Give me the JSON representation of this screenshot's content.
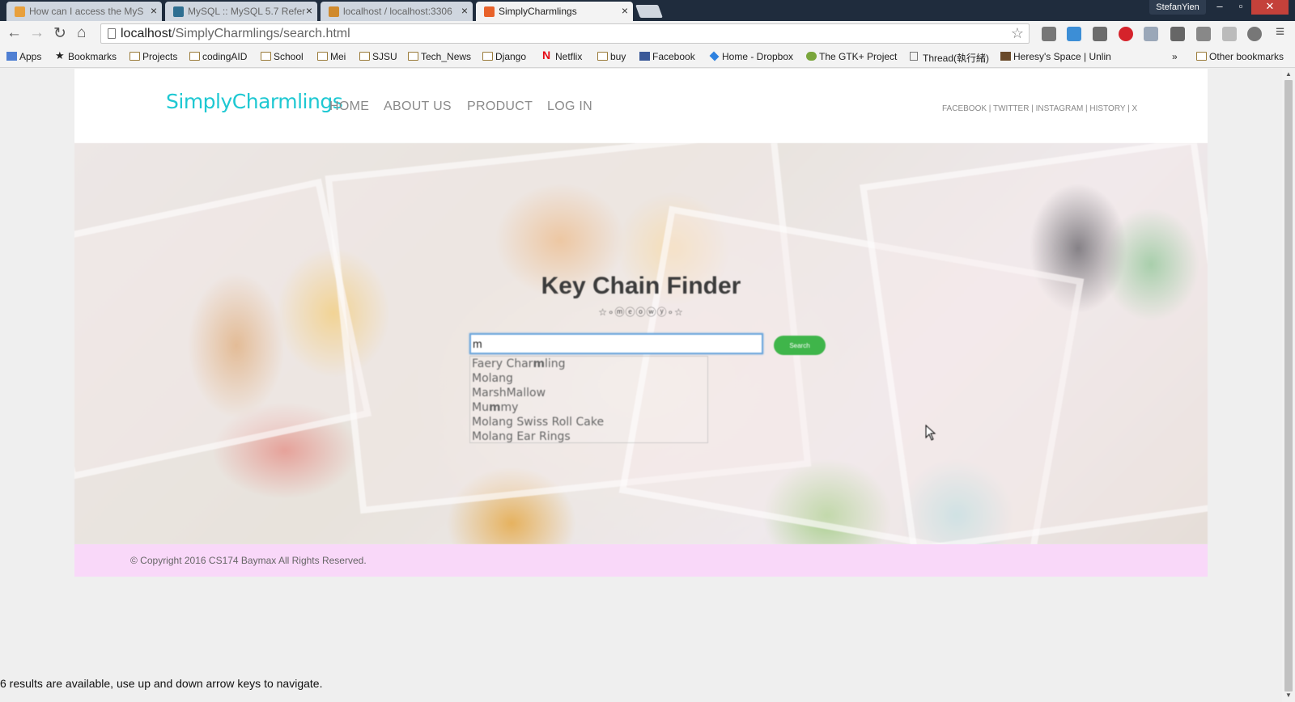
{
  "browser": {
    "tabs": [
      {
        "title": "How can I access the MyS",
        "active": false,
        "favicon_color": "#e8a03c"
      },
      {
        "title": "MySQL :: MySQL 5.7 Refer",
        "active": false,
        "favicon_color": "#2f6f91"
      },
      {
        "title": "localhost / localhost:3306",
        "active": false,
        "favicon_color": "#d08a2c"
      },
      {
        "title": "SimplyCharmlings",
        "active": true,
        "favicon_color": "#e8622a"
      }
    ],
    "profile_name": "StefanYien",
    "window_controls": {
      "minimize": "–",
      "maximize": "▫",
      "close": "✕"
    },
    "url_host": "localhost",
    "url_path": "/SimplyCharmlings/search.html",
    "bookmarks": [
      {
        "label": "Apps",
        "icon": "apps-grid-icon"
      },
      {
        "label": "Bookmarks",
        "icon": "star-icon"
      },
      {
        "label": "Projects",
        "icon": "folder-icon"
      },
      {
        "label": "codingAID",
        "icon": "folder-icon"
      },
      {
        "label": "School",
        "icon": "folder-icon"
      },
      {
        "label": "Mei",
        "icon": "folder-icon"
      },
      {
        "label": "SJSU",
        "icon": "folder-icon"
      },
      {
        "label": "Tech_News",
        "icon": "folder-icon"
      },
      {
        "label": "Django",
        "icon": "folder-icon"
      },
      {
        "label": "Netflix",
        "icon": "netflix-icon"
      },
      {
        "label": "buy",
        "icon": "folder-icon"
      },
      {
        "label": "Facebook",
        "icon": "facebook-icon"
      },
      {
        "label": "Home - Dropbox",
        "icon": "dropbox-icon"
      },
      {
        "label": "The GTK+ Project",
        "icon": "gtk-icon"
      },
      {
        "label": "Thread(執行緒)",
        "icon": "page-icon"
      },
      {
        "label": "Heresy's Space | Unlin",
        "icon": "pen-icon"
      }
    ],
    "bookmarks_overflow": "»",
    "other_bookmarks": "Other bookmarks"
  },
  "site": {
    "logo": "SimplyCharmlings",
    "nav": [
      "HOME",
      "ABOUT US",
      "PRODUCT",
      "LOG IN"
    ],
    "social": "FACEBOOK  |   TWITTER  |   INSTAGRAM  |   HISTORY  |   X",
    "hero": {
      "title": "Key Chain Finder",
      "decoration": "☆∘ⓜⓔⓞⓦⓨ∘☆",
      "search_value": "m",
      "search_button": "Search",
      "suggestions": [
        {
          "before": "Faery Char",
          "match": "m",
          "after": "ling"
        },
        {
          "before": "",
          "match": "M",
          "after": "olang"
        },
        {
          "before": "",
          "match": "M",
          "after": "arshMallow"
        },
        {
          "before": "Mu",
          "match": "m",
          "after": "my"
        },
        {
          "before": "",
          "match": "M",
          "after": "olang Swiss Roll Cake"
        },
        {
          "before": "",
          "match": "M",
          "after": "olang Ear Rings"
        }
      ]
    },
    "footer": "© Copyright 2016 CS174 Baymax All Rights Reserved."
  },
  "a11y_status": "6 results are available, use up and down arrow keys to navigate.",
  "colors": {
    "logo": "#1ec8d2",
    "search_button": "#3fb54a",
    "footer_bg": "#f9d8f9",
    "tabbar_bg": "#1f2c3d"
  }
}
